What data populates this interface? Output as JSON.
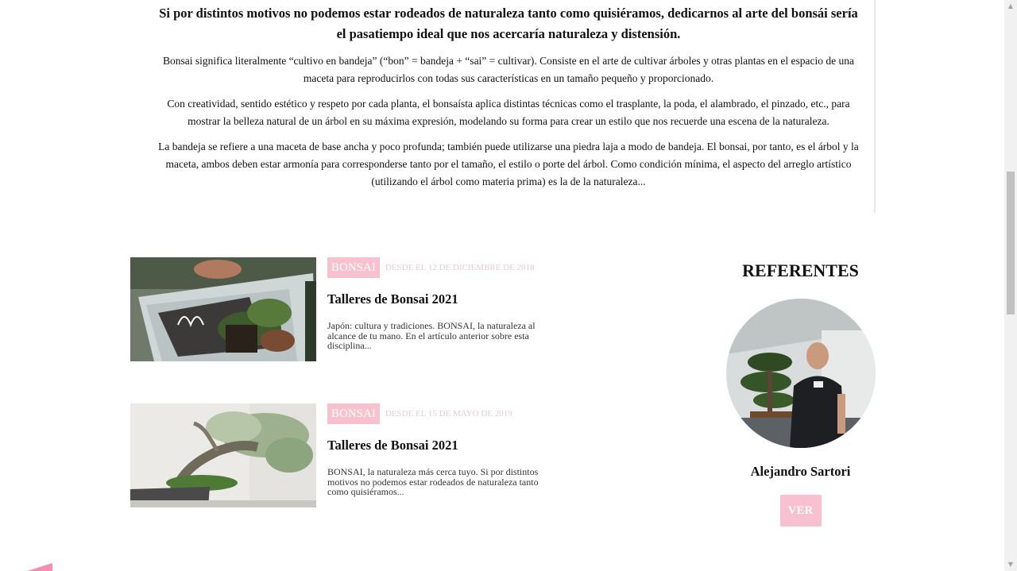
{
  "intro": {
    "heading": "Si por distintos motivos no podemos estar rodeados de naturaleza tanto como quisiéramos, dedicarnos al arte del bonsái sería el pasatiempo ideal que nos acercaría naturaleza y distensión.",
    "paragraphs": [
      "Bonsai significa literalmente “cultivo en bandeja” (“bon” = bandeja + “sai” = cultivar). Consiste en el arte de cultivar árboles y otras plantas en el espacio de una maceta para reproducirlos con todas sus características en un tamaño pequeño y proporcionado.",
      "Con creatividad, sentido estético y respeto por cada planta, el bonsaísta aplica distintas técnicas como el trasplante, la poda, el alambrado, el pinzado, etc., para mostrar la belleza natural de un árbol en su máxima expresión, modelando su forma para crear un estilo que nos recuerde una escena de la naturaleza.",
      "La bandeja se refiere a una maceta de base ancha y poco profunda; también puede utilizarse una piedra laja a modo de bandeja. El bonsai, por tanto, es el árbol y la maceta, ambos deben estar armonía para corresponderse tanto por el tamaño, el estilo o porte del árbol. Como condición mínima, el aspecto del arreglo artístico (utilizando el árbol como materia prima) es la de la naturaleza..."
    ]
  },
  "posts": [
    {
      "category": "BONSAI",
      "date": "DESDE EL 12 DE DICIEMBRE DE 2018",
      "title": "Talleres de Bonsai 2021",
      "excerpt": "Japón: cultura y tradiciones. BONSAI, la naturaleza al alcance de tu mano. En el artículo anterior sobre esta disciplina..."
    },
    {
      "category": "BONSAI",
      "date": "DESDE EL 15 DE MAYO DE 2019",
      "title": "Talleres de Bonsai 2021",
      "excerpt": "BONSAI, la naturaleza más cerca tuyo. Si por distintos motivos no podemos estar rodeados de naturaleza tanto como quisiéramos..."
    }
  ],
  "sidebar": {
    "heading": "REFERENTES",
    "referent_name": "Alejandro Sartori",
    "button_label": "VER"
  },
  "colors": {
    "accent_pink": "#f8c1cf",
    "date_gray": "#e2cdd3"
  },
  "icons": {
    "scroll_up": "scroll-up-arrow-icon",
    "scroll_down": "scroll-down-arrow-icon"
  }
}
